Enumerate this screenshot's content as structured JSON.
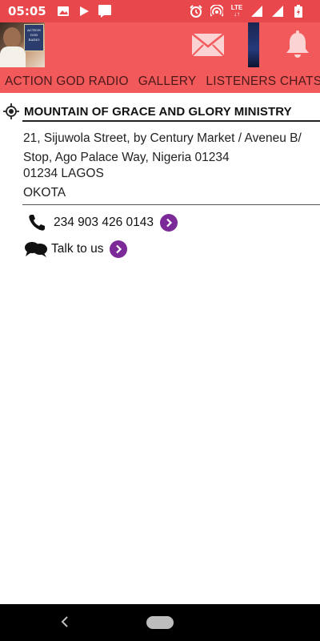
{
  "status_bar": {
    "time": "05:05",
    "network_label": "LTE"
  },
  "app_bar": {
    "logo_text": "ACTION GOD RADIO"
  },
  "tabs": [
    {
      "label": "ACTION GOD RADIO"
    },
    {
      "label": "GALLERY"
    },
    {
      "label": "LISTENERS CHATS"
    }
  ],
  "listing": {
    "title": "MOUNTAIN OF GRACE AND GLORY MINISTRY",
    "address": "21, Sijuwola Street, by Century Market / Aveneu B/ Stop, Ago Palace Way, Nigeria 01234",
    "city": "01234 LAGOS",
    "area": "OKOTA",
    "phone": "234 903 426 0143",
    "talk_label": "Talk to us"
  },
  "colors": {
    "header": "#f2595b",
    "status_bar": "#e8484b",
    "accent": "#7b2a98"
  }
}
